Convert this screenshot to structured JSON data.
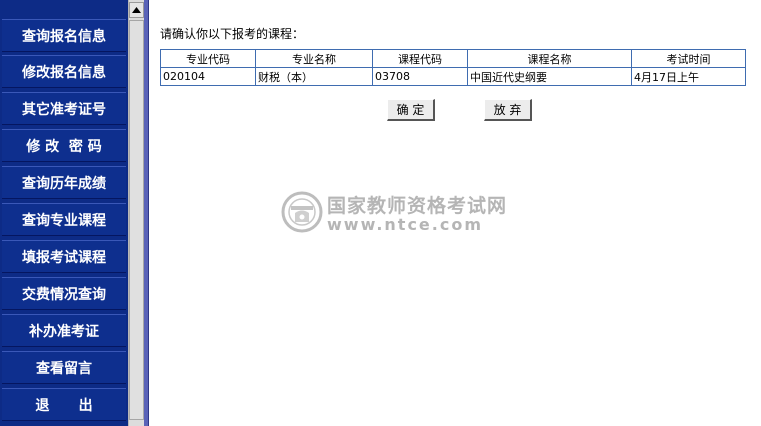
{
  "sidebar": {
    "items": [
      {
        "label": "查询报名信息"
      },
      {
        "label": "修改报名信息"
      },
      {
        "label": "其它准考证号"
      },
      {
        "label": "修 改  密 码"
      },
      {
        "label": "查询历年成绩"
      },
      {
        "label": "查询专业课程"
      },
      {
        "label": "填报考试课程"
      },
      {
        "label": "交费情况查询"
      },
      {
        "label": "补办准考证"
      },
      {
        "label": "查看留言"
      },
      {
        "label": "退      出"
      }
    ]
  },
  "main": {
    "prompt": "请确认你以下报考的课程：",
    "table": {
      "headers": [
        "专业代码",
        "专业名称",
        "课程代码",
        "课程名称",
        "考试时间"
      ],
      "rows": [
        [
          "020104",
          "财税（本）",
          "03708",
          "中国近代史纲要",
          "4月17日上午"
        ]
      ]
    },
    "buttons": {
      "confirm": "确 定",
      "abandon": "放 弃"
    }
  },
  "watermark": {
    "title": "国家教师资格考试网",
    "url": "www.ntce.com",
    "icon": "ntce-logo-icon"
  },
  "colors": {
    "sidebar_bg": "#0e2f8e",
    "table_border": "#3f6cb0",
    "divider": "#5a63b8",
    "watermark": "#b5b5b5"
  }
}
